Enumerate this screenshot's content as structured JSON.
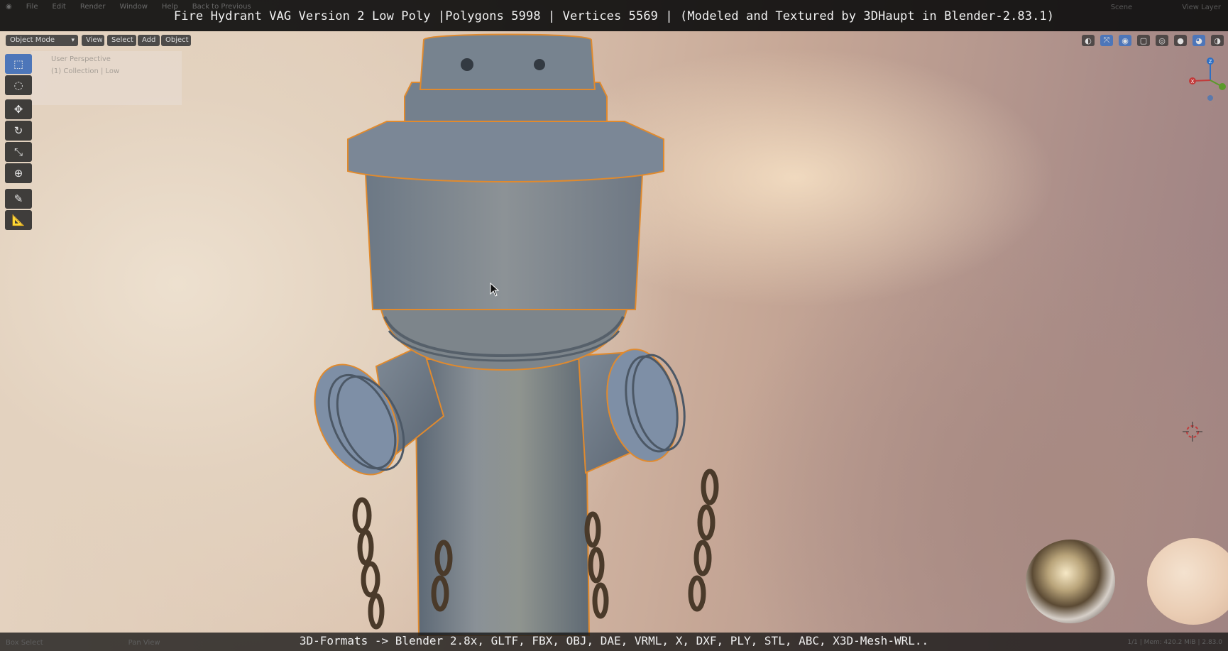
{
  "app": {
    "title": "Fire Hydrant VAG Version 2 Low Poly |Polygons 5998 | Vertices 5569 | (Modeled and Textured by 3DHaupt in Blender-2.83.1)",
    "footer": "3D-Formats -> Blender 2.8x, GLTF, FBX, OBJ, DAE, VRML, X, DXF, PLY, STL, ABC, X3D-Mesh-WRL.."
  },
  "menu": {
    "items": [
      "File",
      "Edit",
      "Render",
      "Window",
      "Help"
    ],
    "back": "Back to Previous",
    "scene": "Scene",
    "view_layer": "View Layer"
  },
  "header": {
    "mode": "Object Mode",
    "view": "View",
    "select": "Select",
    "add": "Add",
    "object": "Object"
  },
  "viewport": {
    "perspective": "User Perspective",
    "collection": "(1) Collection | Low"
  },
  "tools": [
    {
      "icon": "select-box-icon"
    },
    {
      "icon": "cursor-icon"
    },
    {
      "icon": "move-icon"
    },
    {
      "icon": "rotate-icon"
    },
    {
      "icon": "scale-icon"
    },
    {
      "icon": "transform-icon"
    },
    {
      "icon": "annotate-icon"
    },
    {
      "icon": "measure-icon"
    }
  ],
  "gizmo": {
    "x_label": "X",
    "y_label": "Y",
    "z_label": "Z"
  },
  "status": {
    "left_1": "Box Select",
    "left_2": "Pan View",
    "right": "1/1 | Mem: 420.2 MiB | 2.83.0"
  },
  "colors": {
    "accent": "#4d76b9",
    "hydrant": "#7d8690",
    "chain": "#4a3a2a",
    "outline": "#e08a2e"
  }
}
